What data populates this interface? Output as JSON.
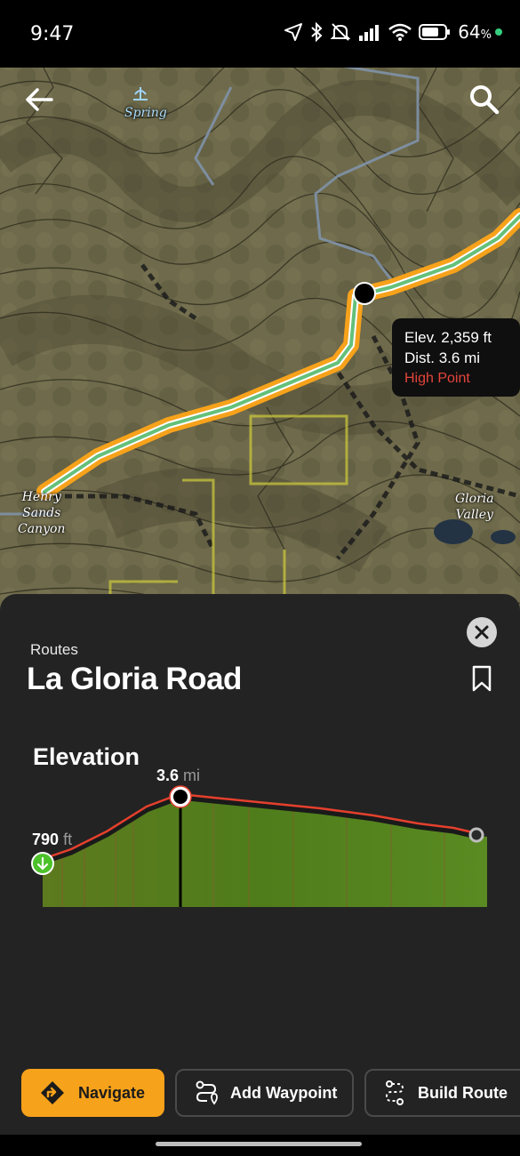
{
  "status_bar": {
    "time": "9:47",
    "battery": "64",
    "battery_unit": "%"
  },
  "map": {
    "labels": {
      "spring": "Spring",
      "henry": "Henry\nSands\nCanyon",
      "gloria_valley": "Gloria\nValley"
    },
    "tooltip": {
      "elevation": "Elev. 2,359 ft",
      "distance": "Dist. 3.6 mi",
      "tag": "High Point"
    },
    "route_colors": {
      "outline": "#f7a21b",
      "inner": "#64c07a"
    }
  },
  "sheet": {
    "section": "Routes",
    "title": "La Gloria Road",
    "elevation_heading": "Elevation",
    "chart": {
      "start_value": "790",
      "start_unit": "ft",
      "peak_value": "3.6",
      "peak_unit": "mi"
    }
  },
  "actions": {
    "navigate": "Navigate",
    "add_waypoint": "Add Waypoint",
    "build_route": "Build Route"
  },
  "icons": [
    "back-arrow-icon",
    "search-icon",
    "close-icon",
    "bookmark-icon",
    "navigate-icon",
    "waypoint-icon",
    "build-route-icon"
  ]
}
